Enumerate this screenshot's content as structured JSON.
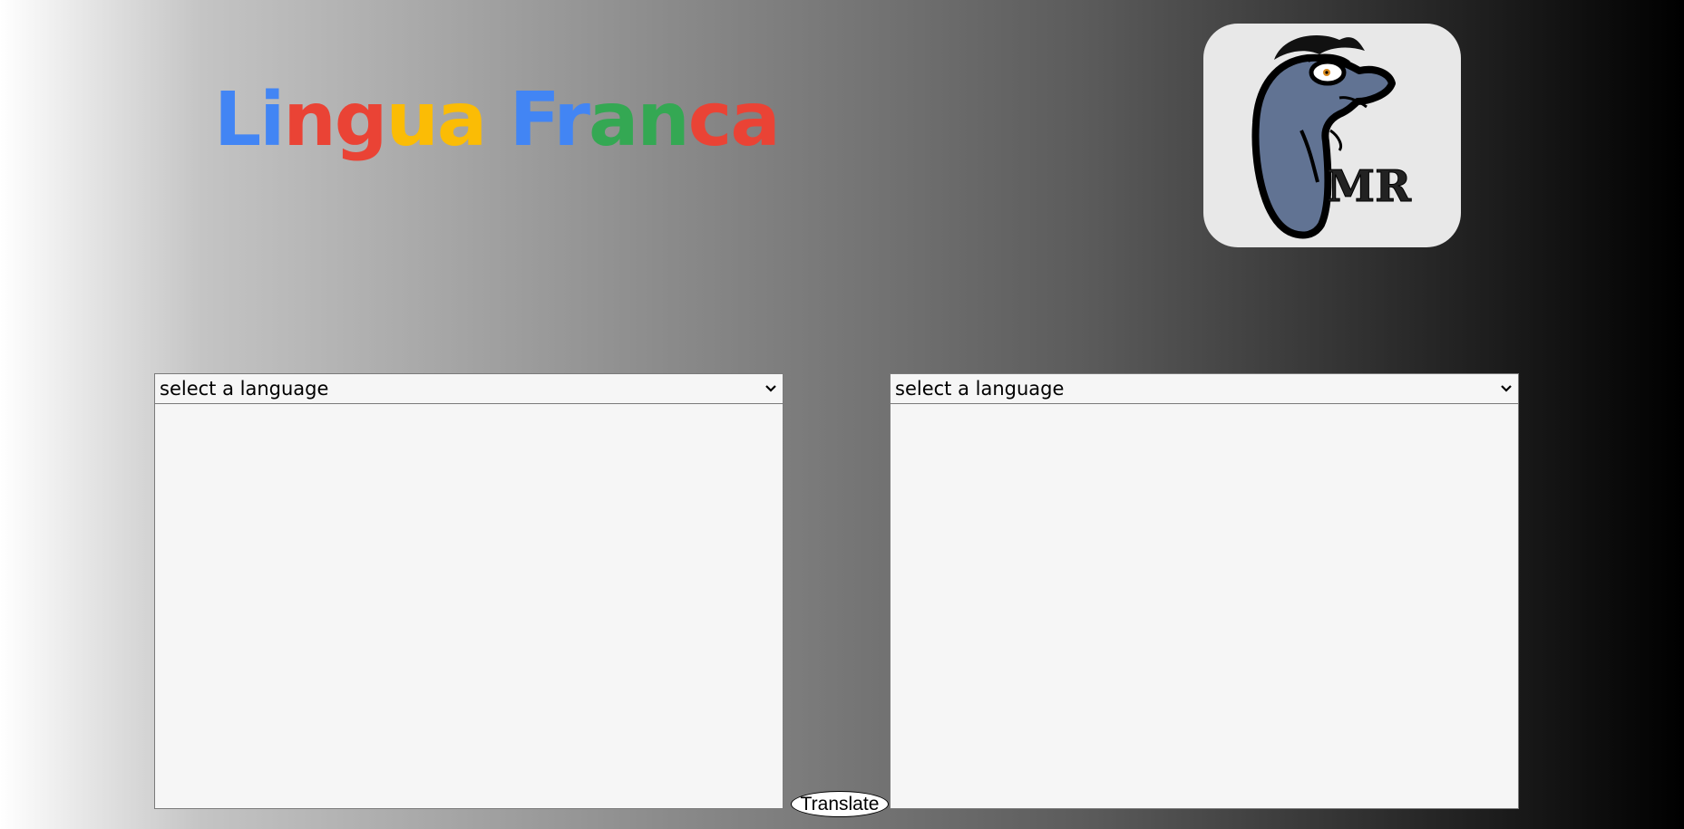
{
  "header": {
    "title_letters": [
      {
        "char": "L",
        "color": "#4285F4"
      },
      {
        "char": "i",
        "color": "#4285F4"
      },
      {
        "char": "n",
        "color": "#EA4335"
      },
      {
        "char": "g",
        "color": "#EA4335"
      },
      {
        "char": "u",
        "color": "#FBBC05"
      },
      {
        "char": "a",
        "color": "#FBBC05"
      },
      {
        "char": " ",
        "color": "#000000"
      },
      {
        "char": "F",
        "color": "#4285F4"
      },
      {
        "char": "r",
        "color": "#4285F4"
      },
      {
        "char": "a",
        "color": "#34A853"
      },
      {
        "char": "n",
        "color": "#34A853"
      },
      {
        "char": "c",
        "color": "#EA4335"
      },
      {
        "char": "a",
        "color": "#EA4335"
      }
    ],
    "logo": {
      "icon": "bird-mascot-logo",
      "text": "MR"
    }
  },
  "source_panel": {
    "select_value": "select a language",
    "text_value": ""
  },
  "target_panel": {
    "select_value": "select a language",
    "text_value": ""
  },
  "translate_button": {
    "label": "Translate"
  }
}
